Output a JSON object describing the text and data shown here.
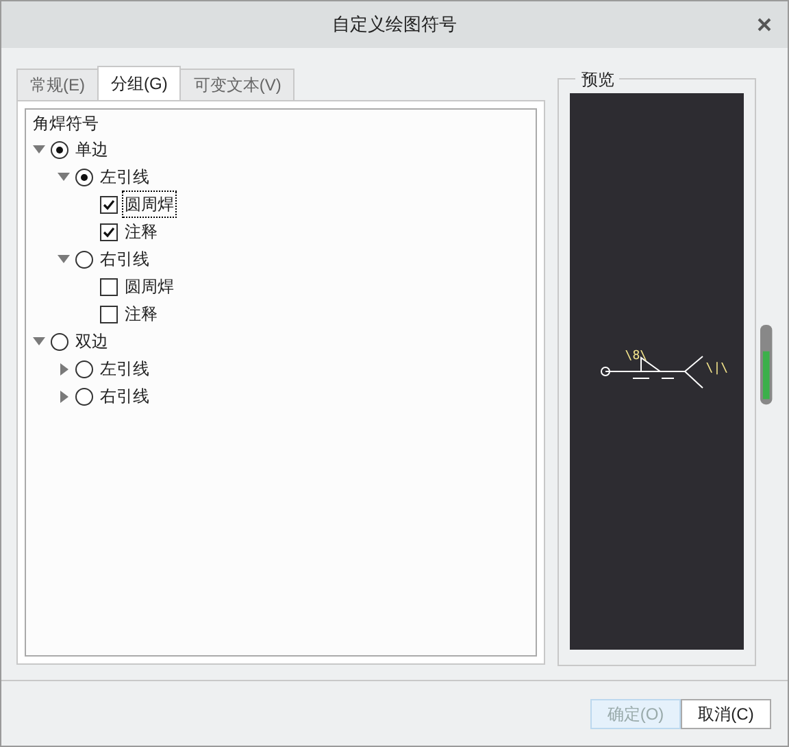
{
  "window": {
    "title": "自定义绘图符号"
  },
  "tabs": [
    {
      "label": "常规(E)",
      "selected": false
    },
    {
      "label": "分组(G)",
      "selected": true
    },
    {
      "label": "可变文本(V)",
      "selected": false
    }
  ],
  "tree": {
    "heading": "角焊符号",
    "items": [
      {
        "kind": "radio",
        "label": "单边",
        "selected": true,
        "expanded": true,
        "children": [
          {
            "kind": "radio",
            "label": "左引线",
            "selected": true,
            "expanded": true,
            "children": [
              {
                "kind": "checkbox",
                "label": "圆周焊",
                "checked": true,
                "focused": true
              },
              {
                "kind": "checkbox",
                "label": "注释",
                "checked": true,
                "focused": false
              }
            ]
          },
          {
            "kind": "radio",
            "label": "右引线",
            "selected": false,
            "expanded": true,
            "children": [
              {
                "kind": "checkbox",
                "label": "圆周焊",
                "checked": false,
                "focused": false
              },
              {
                "kind": "checkbox",
                "label": "注释",
                "checked": false,
                "focused": false
              }
            ]
          }
        ]
      },
      {
        "kind": "radio",
        "label": "双边",
        "selected": false,
        "expanded": true,
        "children": [
          {
            "kind": "radio",
            "label": "左引线",
            "selected": false,
            "expanded": false
          },
          {
            "kind": "radio",
            "label": "右引线",
            "selected": false,
            "expanded": false
          }
        ]
      }
    ]
  },
  "preview": {
    "title": "预览",
    "labels": [
      "\\8\\",
      "\\|\\"
    ]
  },
  "buttons": [
    {
      "label": "确定(O)",
      "disabled": true
    },
    {
      "label": "取消(C)",
      "disabled": false
    }
  ]
}
